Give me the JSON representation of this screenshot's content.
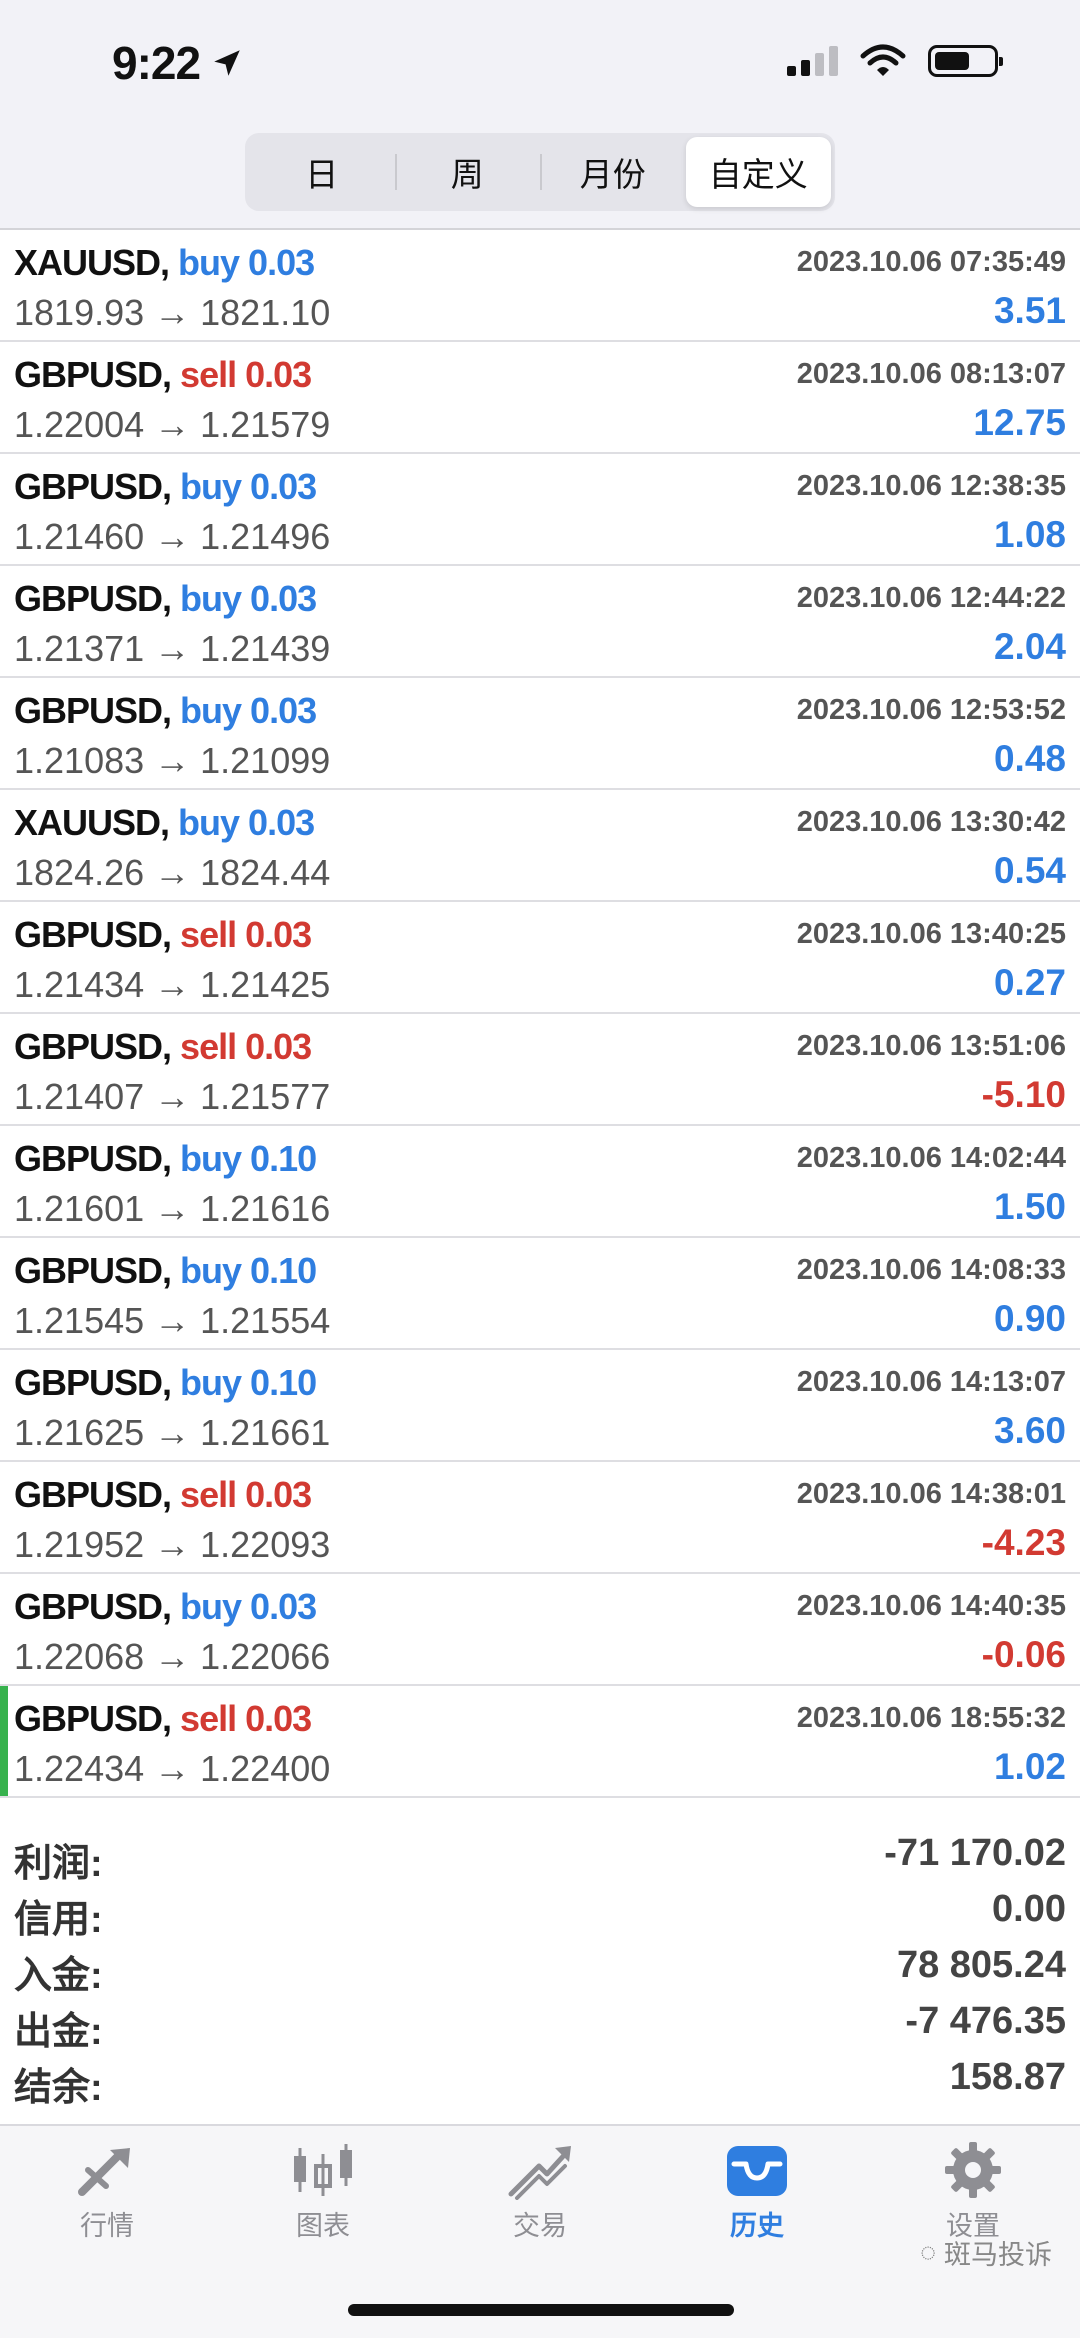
{
  "status_bar": {
    "time": "9:22",
    "location_icon": "location-arrow-icon",
    "signal_icon": "cellular-signal-icon",
    "wifi_icon": "wifi-icon",
    "battery_icon": "battery-icon",
    "battery_level": 0.6
  },
  "period_tabs": [
    {
      "label": "日",
      "active": false
    },
    {
      "label": "周",
      "active": false
    },
    {
      "label": "月份",
      "active": false
    },
    {
      "label": "自定义",
      "active": true
    }
  ],
  "deals": [
    {
      "symbol": "XAUUSD,",
      "action": "buy 0.03",
      "side": "buy",
      "date": "2023.10.06 07:35:49",
      "prices": "1819.93 → 1821.10",
      "profit": "3.51"
    },
    {
      "symbol": "GBPUSD,",
      "action": "sell 0.03",
      "side": "sell",
      "date": "2023.10.06 08:13:07",
      "prices": "1.22004 → 1.21579",
      "profit": "12.75"
    },
    {
      "symbol": "GBPUSD,",
      "action": "buy 0.03",
      "side": "buy",
      "date": "2023.10.06 12:38:35",
      "prices": "1.21460 → 1.21496",
      "profit": "1.08"
    },
    {
      "symbol": "GBPUSD,",
      "action": "buy 0.03",
      "side": "buy",
      "date": "2023.10.06 12:44:22",
      "prices": "1.21371 → 1.21439",
      "profit": "2.04"
    },
    {
      "symbol": "GBPUSD,",
      "action": "buy 0.03",
      "side": "buy",
      "date": "2023.10.06 12:53:52",
      "prices": "1.21083 → 1.21099",
      "profit": "0.48"
    },
    {
      "symbol": "XAUUSD,",
      "action": "buy 0.03",
      "side": "buy",
      "date": "2023.10.06 13:30:42",
      "prices": "1824.26 → 1824.44",
      "profit": "0.54"
    },
    {
      "symbol": "GBPUSD,",
      "action": "sell 0.03",
      "side": "sell",
      "date": "2023.10.06 13:40:25",
      "prices": "1.21434 → 1.21425",
      "profit": "0.27"
    },
    {
      "symbol": "GBPUSD,",
      "action": "sell 0.03",
      "side": "sell",
      "date": "2023.10.06 13:51:06",
      "prices": "1.21407 → 1.21577",
      "profit": "-5.10"
    },
    {
      "symbol": "GBPUSD,",
      "action": "buy 0.10",
      "side": "buy",
      "date": "2023.10.06 14:02:44",
      "prices": "1.21601 → 1.21616",
      "profit": "1.50"
    },
    {
      "symbol": "GBPUSD,",
      "action": "buy 0.10",
      "side": "buy",
      "date": "2023.10.06 14:08:33",
      "prices": "1.21545 → 1.21554",
      "profit": "0.90"
    },
    {
      "symbol": "GBPUSD,",
      "action": "buy 0.10",
      "side": "buy",
      "date": "2023.10.06 14:13:07",
      "prices": "1.21625 → 1.21661",
      "profit": "3.60"
    },
    {
      "symbol": "GBPUSD,",
      "action": "sell 0.03",
      "side": "sell",
      "date": "2023.10.06 14:38:01",
      "prices": "1.21952 → 1.22093",
      "profit": "-4.23"
    },
    {
      "symbol": "GBPUSD,",
      "action": "buy 0.03",
      "side": "buy",
      "date": "2023.10.06 14:40:35",
      "prices": "1.22068 → 1.22066",
      "profit": "-0.06"
    },
    {
      "symbol": "GBPUSD,",
      "action": "sell 0.03",
      "side": "sell",
      "date": "2023.10.06 18:55:32",
      "prices": "1.22434 → 1.22400",
      "profit": "1.02",
      "highlighted": true
    }
  ],
  "summary": [
    {
      "label": "利润:",
      "value": "-71 170.02"
    },
    {
      "label": "信用:",
      "value": "0.00"
    },
    {
      "label": "入金:",
      "value": "78 805.24"
    },
    {
      "label": "出金:",
      "value": "-7 476.35"
    },
    {
      "label": "结余:",
      "value": "158.87"
    }
  ],
  "tabbar": [
    {
      "label": "行情",
      "icon": "quotes-arrows-icon",
      "active": false
    },
    {
      "label": "图表",
      "icon": "candlestick-chart-icon",
      "active": false
    },
    {
      "label": "交易",
      "icon": "trade-trend-icon",
      "active": false
    },
    {
      "label": "历史",
      "icon": "history-tray-icon",
      "active": true
    },
    {
      "label": "设置",
      "icon": "gear-icon",
      "active": false
    }
  ],
  "watermark": "斑马投诉",
  "colors": {
    "buy": "#2f7ee0",
    "sell": "#d23a32",
    "active_tab": "#2f7ee0",
    "inactive_tab": "#8e8e93",
    "highlight_bar": "#37b24d"
  }
}
